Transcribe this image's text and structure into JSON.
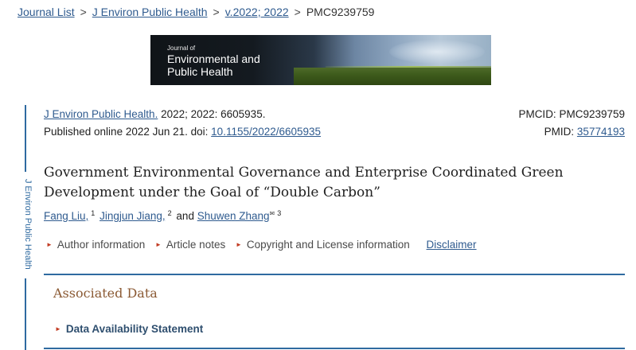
{
  "breadcrumb": {
    "journal_list": "Journal List",
    "journal": "J Environ Public Health",
    "volume": "v.2022; 2022",
    "pmc": "PMC9239759",
    "separator": ">"
  },
  "banner": {
    "journal_of": "Journal of",
    "line1": "Environmental and",
    "line2": "Public Health"
  },
  "side_label": "J Environ Public Health",
  "citation": {
    "journal_link": "J Environ Public Health.",
    "details": " 2022; 2022: 6605935.",
    "published_prefix": "Published online 2022 Jun 21. doi: ",
    "doi": "10.1155/2022/6605935",
    "pmcid": "PMCID: PMC9239759",
    "pmid_label": "PMID: ",
    "pmid": "35774193"
  },
  "title": "Government Environmental Governance and Enterprise Coordinated Green Development under the Goal of “Double Carbon”",
  "authors": {
    "a1": "Fang Liu,",
    "a1_sup": "1",
    "a2": "Jingjun Jiang,",
    "a2_sup": "2",
    "and": "and",
    "a3": "Shuwen Zhang",
    "a3_mark": "✉",
    "a3_sup": "3"
  },
  "info_links": {
    "author_info": "Author information",
    "article_notes": "Article notes",
    "copyright": "Copyright and License information",
    "disclaimer": "Disclaimer"
  },
  "associated": {
    "heading": "Associated Data",
    "data_availability": "Data Availability Statement"
  },
  "colors": {
    "link": "#2f5b8f",
    "rule": "#2f6aa0",
    "heading": "#8b5a34",
    "triangle": "#c23b22"
  }
}
